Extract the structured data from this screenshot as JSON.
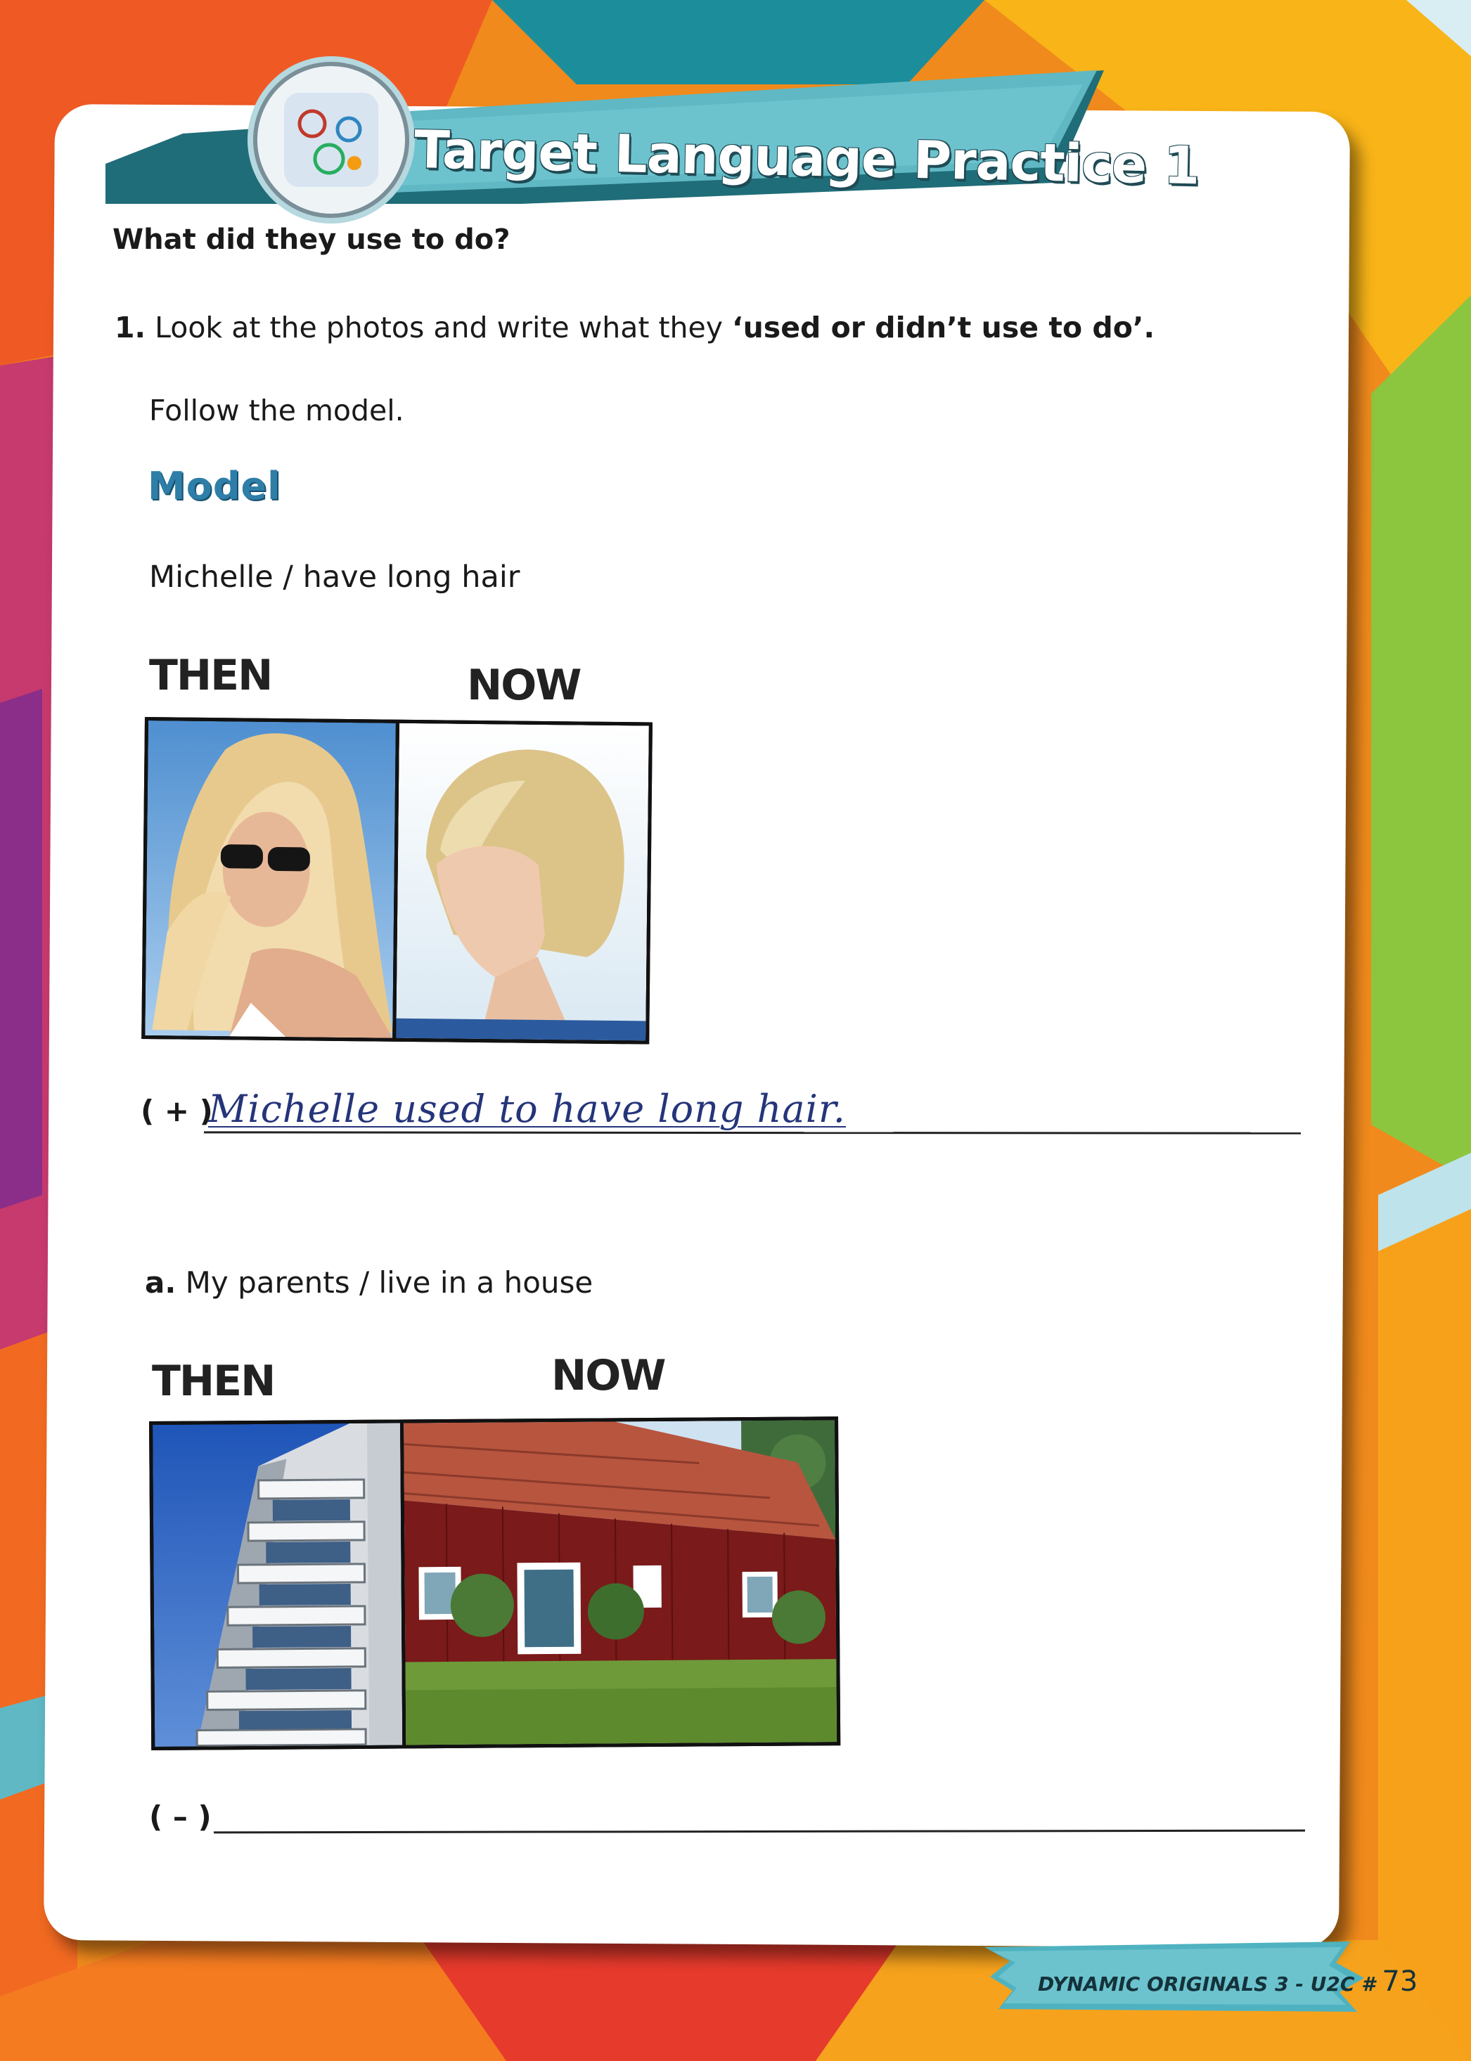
{
  "banner": {
    "title": "Target Language Practice  1"
  },
  "section": {
    "question": "What did they use to do?"
  },
  "exercise": {
    "number": "1.",
    "instruction_start": " Look at the photos and write what they ",
    "instruction_bold": "‘used or didn’t use to do’",
    "instruction_end": ".",
    "follow": "Follow the model."
  },
  "model": {
    "heading": "Model",
    "prompt": "Michelle / have long hair",
    "then_label": "THEN",
    "now_label": "NOW",
    "sign": "( + )",
    "answer": "Michelle used to have long hair."
  },
  "item_a": {
    "letter": "a.",
    "prompt": " My parents / live in a house",
    "then_label": "THEN",
    "now_label": "NOW",
    "sign": "( – )",
    "answer": ""
  },
  "footer": {
    "book": "DYNAMIC ORIGINALS 3 - U2C #",
    "page": "73"
  },
  "colors": {
    "accent_teal": "#5fb8c4",
    "model_blue": "#2e7ea8",
    "handwriting": "#25357a"
  }
}
